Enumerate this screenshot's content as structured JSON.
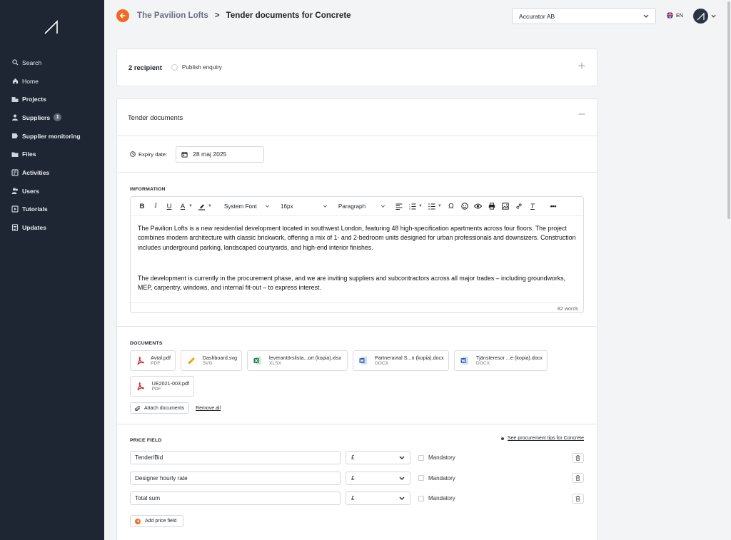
{
  "sidebar": {
    "items": [
      {
        "label": "Search",
        "icon": "search-icon"
      },
      {
        "label": "Home",
        "icon": "home-icon"
      },
      {
        "label": "Projects",
        "icon": "projects-icon"
      },
      {
        "label": "Suppliers",
        "icon": "suppliers-icon",
        "count": "1"
      },
      {
        "label": "Supplier monitoring",
        "icon": "monitoring-icon"
      },
      {
        "label": "Files",
        "icon": "folder-icon"
      },
      {
        "label": "Activities",
        "icon": "activities-icon"
      },
      {
        "label": "Users",
        "icon": "users-icon"
      },
      {
        "label": "Tutorials",
        "icon": "tutorials-icon"
      },
      {
        "label": "Updates",
        "icon": "updates-icon"
      }
    ]
  },
  "header": {
    "breadcrumb_parent": "The Pavilion Lofts",
    "breadcrumb_separator": ">",
    "breadcrumb_current": "Tender documents for Concrete",
    "company": "Accurator AB",
    "language": "EN"
  },
  "recipients": {
    "count_label": "2 recipient",
    "publish_label": "Publish enquiry"
  },
  "tender": {
    "title": "Tender documents",
    "expiry_label": "Expiry date:",
    "expiry_value": "28 maj 2025",
    "information_title": "INFORMATION",
    "toolbar": {
      "font": "System Font",
      "size": "16px",
      "block": "Paragraph"
    },
    "paragraph_1": "The Pavilion Lofts is a new residential development located in southwest London, featuring 48 high-specification apartments across four floors. The project combines modern architecture with classic brickwork, offering a mix of 1- and 2-bedroom units designed for urban professionals and downsizers. Construction includes underground parking, landscaped courtyards, and high-end interior finishes.",
    "paragraph_2": "The development is currently in the procurement phase, and we are inviting suppliers and subcontractors across all major trades – including groundworks, MEP, carpentry, windows, and internal fit-out – to express interest.",
    "word_count": "82 words",
    "documents_title": "DOCUMENTS",
    "documents": [
      {
        "name": "Avtal.pdf",
        "type": "PDF"
      },
      {
        "name": "Dashboard.svg",
        "type": "SVG"
      },
      {
        "name": "leverantörslista...ort (kopia).xlsx",
        "type": "XLSX"
      },
      {
        "name": "Partneravtal S...n (kopia).docx",
        "type": "DOCX"
      },
      {
        "name": "Tjänsteresor ...e (kopia).docx",
        "type": "DOCX"
      },
      {
        "name": "UE2021-003.pdf",
        "type": "PDF"
      }
    ],
    "attach_label": "Attach documents",
    "remove_all_label": "Remove all",
    "price_title": "PRICE FIELD",
    "tips_label": "See procurement tips for Concrete",
    "price_fields": [
      {
        "name": "Tender/Bid",
        "currency": "£",
        "mandatory_label": "Mandatory"
      },
      {
        "name": "Designer hourly rate",
        "currency": "£",
        "mandatory_label": "Mandatory"
      },
      {
        "name": "Total sum",
        "currency": "£",
        "mandatory_label": "Mandatory"
      }
    ],
    "add_price_label": "Add price field"
  },
  "colors": {
    "sidebar_bg": "#1e2633",
    "accent": "#f06a23"
  }
}
